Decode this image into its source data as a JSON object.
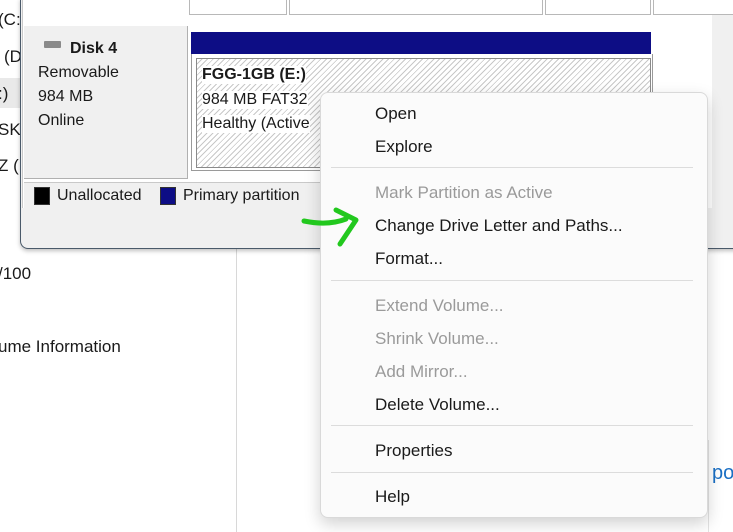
{
  "background_list": {
    "items": [
      "(C:",
      "(D",
      ":)",
      "SK",
      "Z (",
      "/100",
      "ume Information"
    ]
  },
  "background_link_fragment": "po",
  "disk": {
    "title": "Disk 4",
    "type": "Removable",
    "size": "984 MB",
    "status": "Online"
  },
  "volume": {
    "title": "FGG-1GB  (E:)",
    "size_fs": "984 MB FAT32",
    "health": "Healthy (Active"
  },
  "legend": {
    "unallocated": "Unallocated",
    "primary": "Primary partition"
  },
  "context_menu": {
    "open": "Open",
    "explore": "Explore",
    "mark_active": "Mark Partition as Active",
    "change_letter": "Change Drive Letter and Paths...",
    "format": "Format...",
    "extend": "Extend Volume...",
    "shrink": "Shrink Volume...",
    "add_mirror": "Add Mirror...",
    "delete": "Delete Volume...",
    "properties": "Properties",
    "help": "Help"
  },
  "colors": {
    "primary_partition": "#0d0d85",
    "unallocated": "#000000",
    "annotation_arrow": "#22c81e",
    "disabled_text": "#9a9a9a"
  },
  "icons": [
    "disk-icon",
    "arrow-annotation-icon"
  ]
}
